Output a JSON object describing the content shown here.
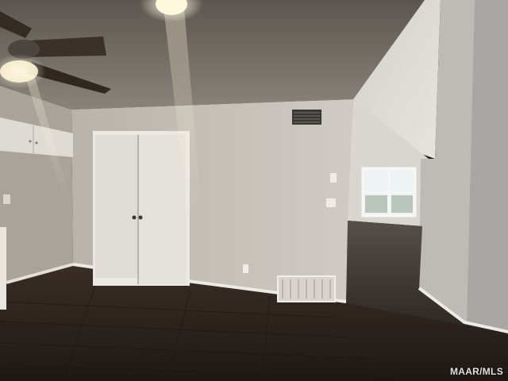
{
  "watermark": {
    "text": "MAAR/MLS"
  },
  "colors": {
    "ceiling": "#6f6760",
    "wall": "#c8c3bb",
    "floor_dark": "#2a211b",
    "vaulted_ceiling": "#dcdad5",
    "trim": "#ece9e3"
  },
  "scene": {
    "type": "photograph",
    "subject": "empty-room-interior"
  }
}
